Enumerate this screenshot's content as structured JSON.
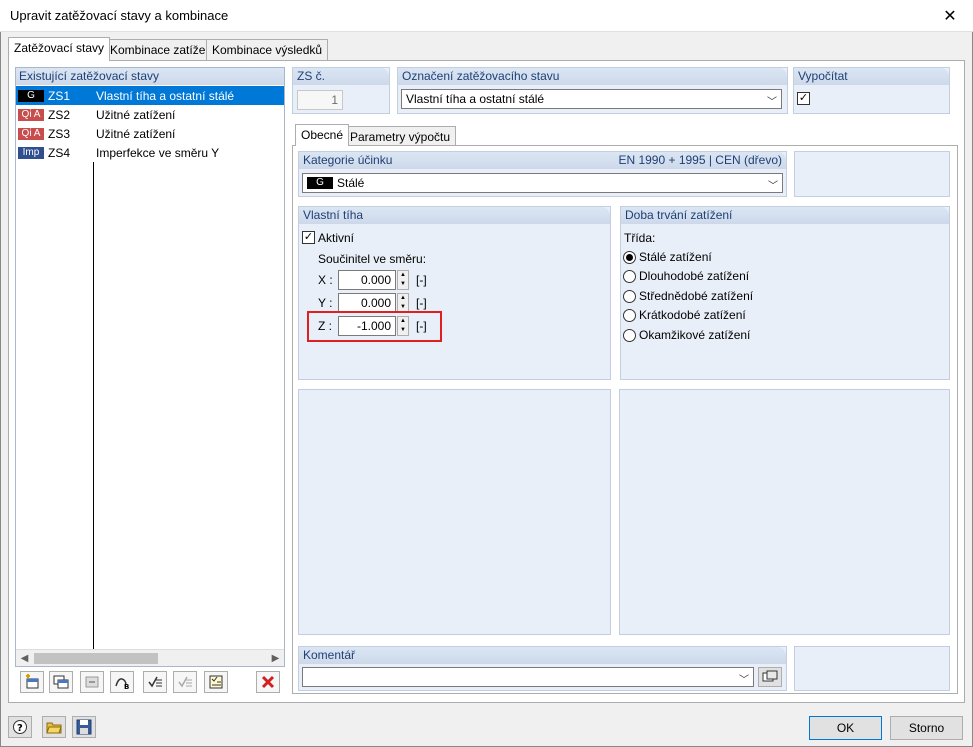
{
  "window": {
    "title": "Upravit zatěžovací stavy a kombinace",
    "close": "✕"
  },
  "tabs": [
    {
      "label": "Zatěžovací stavy",
      "active": true
    },
    {
      "label": "Kombinace zatížení",
      "active": false
    },
    {
      "label": "Kombinace výsledků",
      "active": false
    }
  ],
  "list": {
    "header": "Existující zatěžovací stavy",
    "rows": [
      {
        "badge": "G",
        "badge_color": "#000000",
        "id": "ZS1",
        "name": "Vlastní tíha a ostatní stálé",
        "selected": true
      },
      {
        "badge": "Qi A",
        "badge_color": "#c84d4d",
        "id": "ZS2",
        "name": "Užitné zatížení",
        "selected": false
      },
      {
        "badge": "Qi A",
        "badge_color": "#c84d4d",
        "id": "ZS3",
        "name": "Užitné zatížení",
        "selected": false
      },
      {
        "badge": "Imp",
        "badge_color": "#2f4f8f",
        "id": "ZS4",
        "name": "Imperfekce ve směru Y",
        "selected": false
      }
    ]
  },
  "zs_no": {
    "label": "ZS č.",
    "value": "1"
  },
  "designation": {
    "label": "Označení zatěžovacího stavu",
    "value": "Vlastní tíha a ostatní stálé"
  },
  "calculate": {
    "label": "Vypočítat",
    "checked": true
  },
  "subtabs": [
    {
      "label": "Obecné",
      "active": true
    },
    {
      "label": "Parametry výpočtu",
      "active": false
    }
  ],
  "category": {
    "label": "Kategorie účinku",
    "standard": "EN 1990 + 1995 | CEN (dřevo)",
    "badge": "G",
    "value": "Stálé"
  },
  "self_weight": {
    "label": "Vlastní tíha",
    "active_label": "Aktivní",
    "active": true,
    "coef_label": "Součinitel ve směru:",
    "rows": [
      {
        "axis": "X :",
        "value": "0.000",
        "unit": "[-]"
      },
      {
        "axis": "Y :",
        "value": "0.000",
        "unit": "[-]"
      },
      {
        "axis": "Z :",
        "value": "-1.000",
        "unit": "[-]",
        "highlighted": true
      }
    ],
    "highlight_color": "#e02020"
  },
  "duration": {
    "label": "Doba trvání zatížení",
    "class_label": "Třída:",
    "options": [
      {
        "label": "Stálé zatížení",
        "selected": true
      },
      {
        "label": "Dlouhodobé zatížení",
        "selected": false
      },
      {
        "label": "Střednědobé zatížení",
        "selected": false
      },
      {
        "label": "Krátkodobé zatížení",
        "selected": false
      },
      {
        "label": "Okamžikové zatížení",
        "selected": false
      }
    ]
  },
  "comment": {
    "label": "Komentář",
    "value": ""
  },
  "buttons": {
    "ok": "OK",
    "cancel": "Storno"
  },
  "icons": {
    "list_toolbar": [
      "new-load-case-icon",
      "copy-load-case-icon",
      "renumber-icon",
      "generate-icon",
      "check-list-icon",
      "uncheck-list-icon",
      "list-settings-icon",
      "delete-icon"
    ],
    "bottom": [
      "help-icon",
      "open-icon",
      "save-icon"
    ]
  }
}
